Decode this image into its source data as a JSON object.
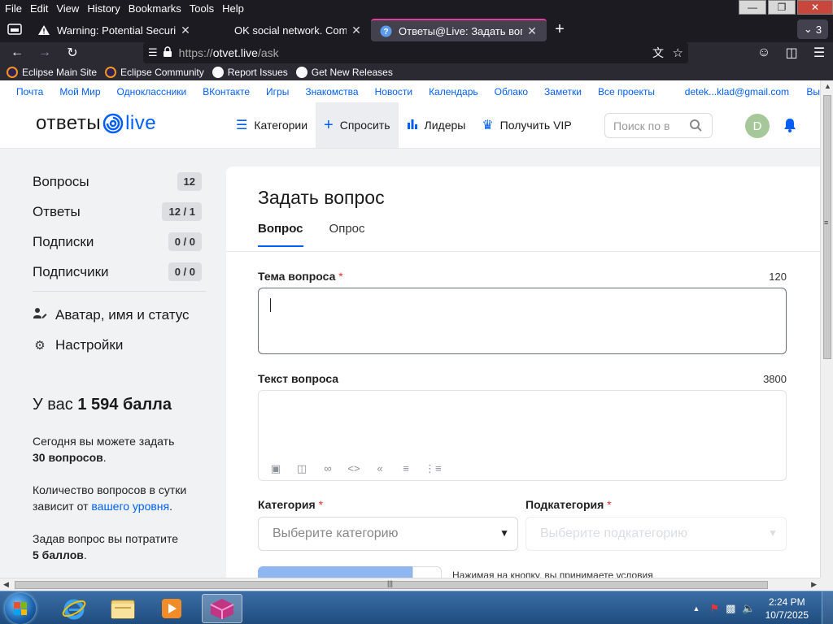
{
  "browser": {
    "menu": [
      "File",
      "Edit",
      "View",
      "History",
      "Bookmarks",
      "Tools",
      "Help"
    ],
    "tabs": [
      {
        "title": "Warning: Potential Security Risk",
        "icon": "warning-icon"
      },
      {
        "title": "OK social network. Communica",
        "icon": "none"
      },
      {
        "title": "Ответы@Live: Задать вопрос",
        "icon": "help-icon"
      }
    ],
    "tab_count": "3",
    "url": {
      "scheme": "https://",
      "host": "otvet.live",
      "path": "/ask"
    },
    "bookmarks": [
      "Eclipse Main Site",
      "Eclipse Community",
      "Report Issues",
      "Get New Releases"
    ]
  },
  "portal": {
    "links": [
      "Почта",
      "Мой Мир",
      "Одноклассники",
      "ВКонтакте",
      "Игры",
      "Знакомства",
      "Новости",
      "Календарь",
      "Облако",
      "Заметки",
      "Все проекты"
    ],
    "email": "detek...klad@gmail.com",
    "more": "Вы"
  },
  "header": {
    "logo_left": "ответы",
    "logo_right": "live",
    "nav": [
      {
        "label": "Категории",
        "icon": "list-icon"
      },
      {
        "label": "Спросить",
        "icon": "plus-icon"
      },
      {
        "label": "Лидеры",
        "icon": "bar-chart-icon"
      },
      {
        "label": "Получить VIP",
        "icon": "crown-icon"
      }
    ],
    "search_placeholder": "Поиск по в",
    "avatar_letter": "D"
  },
  "sidebar": {
    "stats": [
      {
        "label": "Вопросы",
        "value": "12"
      },
      {
        "label": "Ответы",
        "value": "12 / 1"
      },
      {
        "label": "Подписки",
        "value": "0 / 0"
      },
      {
        "label": "Подписчики",
        "value": "0 / 0"
      }
    ],
    "links": [
      {
        "label": "Аватар, имя и статус",
        "icon": "user-edit-icon"
      },
      {
        "label": "Настройки",
        "icon": "gear-icon"
      }
    ],
    "points_prefix": "У вас",
    "points_value": "1 594 балла",
    "info1_text": "Сегодня вы можете задать",
    "info1_bold": "30 вопросов",
    "info2_text": "Количество вопросов в сутки зависит от",
    "info2_link": "вашего уровня",
    "info3_text": "Задав вопрос вы потратите",
    "info3_bold": "5 баллов"
  },
  "form": {
    "title": "Задать вопрос",
    "tabs": [
      "Вопрос",
      "Опрос"
    ],
    "topic_label": "Тема вопроса",
    "topic_limit": "120",
    "text_label": "Текст вопроса",
    "text_limit": "3800",
    "category_label": "Категория",
    "category_placeholder": "Выберите категорию",
    "subcategory_label": "Подкатегория",
    "subcategory_placeholder": "Выберите подкатегорию",
    "terms_text": "Нажимая на кнопку, вы принимаете условия"
  },
  "taskbar": {
    "time": "2:24 PM",
    "date": "10/7/2025"
  }
}
